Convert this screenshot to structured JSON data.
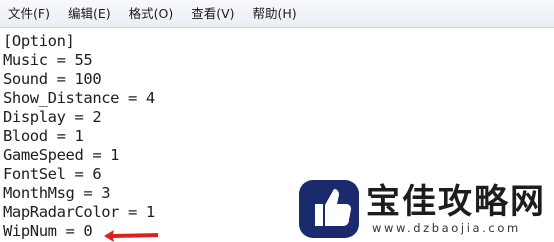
{
  "menubar": {
    "items": [
      {
        "label": "文件(F)"
      },
      {
        "label": "编辑(E)"
      },
      {
        "label": "格式(O)"
      },
      {
        "label": "查看(V)"
      },
      {
        "label": "帮助(H)"
      }
    ]
  },
  "editor": {
    "lines": [
      "[Option]",
      "Music = 55",
      "Sound = 100",
      "Show_Distance = 4",
      "Display = 2",
      "Blood = 1",
      "GameSpeed = 1",
      "FontSel = 6",
      "MonthMsg = 3",
      "MapRadarColor = 1",
      "WipNum = 0"
    ]
  },
  "annotation": {
    "arrow_color": "#e02020"
  },
  "watermark": {
    "title": "宝佳攻略网",
    "url": "www.dzbaojia.com",
    "logo_color": "#1a2a6c"
  }
}
